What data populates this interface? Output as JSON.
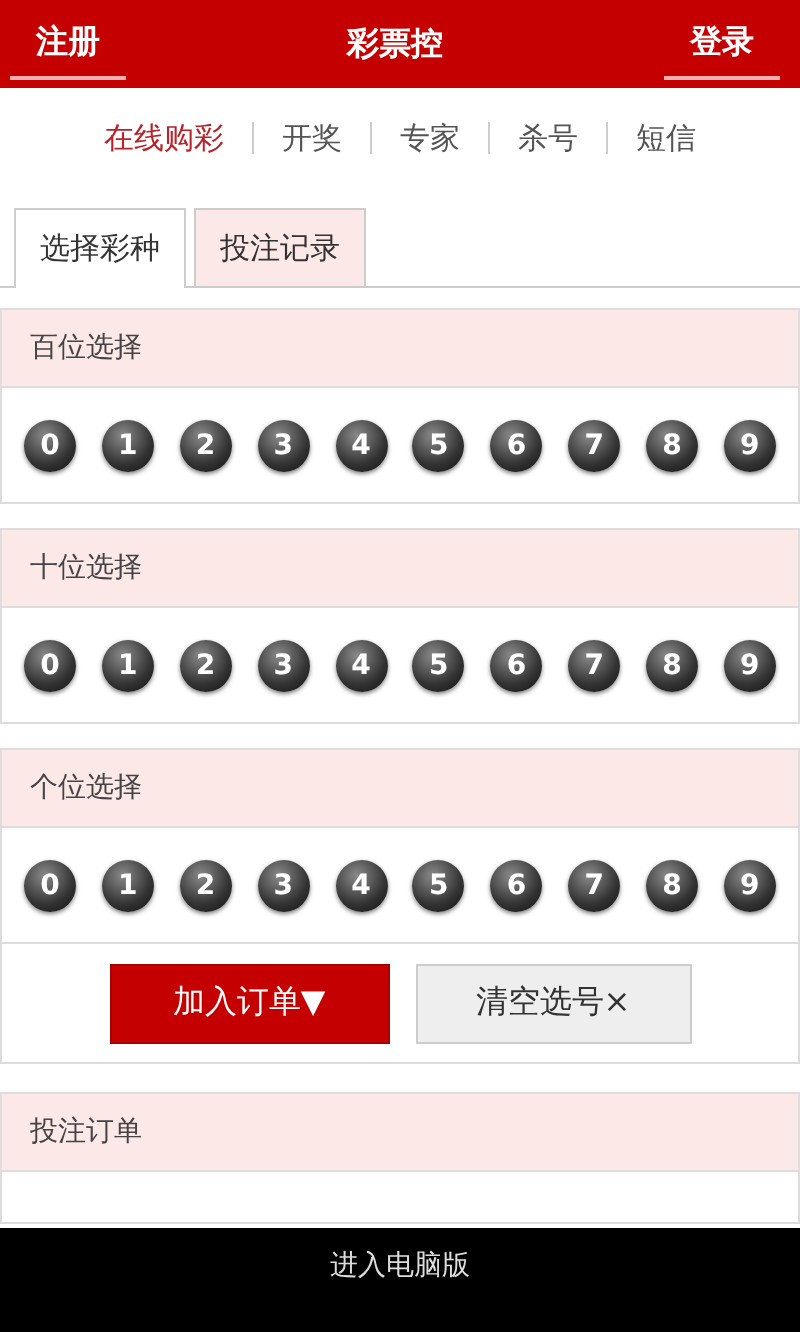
{
  "header": {
    "left_link": "注册",
    "title": "彩票控",
    "right_link": "登录"
  },
  "nav": [
    {
      "label": "在线购彩",
      "selected": true
    },
    {
      "label": "开奖",
      "selected": false
    },
    {
      "label": "专家",
      "selected": false
    },
    {
      "label": "杀号",
      "selected": false
    },
    {
      "label": "短信",
      "selected": false
    }
  ],
  "tabs": [
    {
      "label": "选择彩种",
      "selected": true
    },
    {
      "label": "投注记录",
      "selected": false
    }
  ],
  "sections": [
    {
      "title": "百位选择",
      "balls": [
        {
          "label": "0",
          "selected": false
        },
        {
          "label": "1",
          "selected": false
        },
        {
          "label": "2",
          "selected": false
        },
        {
          "label": "3",
          "selected": false
        },
        {
          "label": "4",
          "selected": false
        },
        {
          "label": "5",
          "selected": false
        },
        {
          "label": "6",
          "selected": false
        },
        {
          "label": "7",
          "selected": false
        },
        {
          "label": "8",
          "selected": false
        },
        {
          "label": "9",
          "selected": false
        }
      ]
    },
    {
      "title": "十位选择",
      "balls": [
        {
          "label": "0",
          "selected": false
        },
        {
          "label": "1",
          "selected": false
        },
        {
          "label": "2",
          "selected": false
        },
        {
          "label": "3",
          "selected": false
        },
        {
          "label": "4",
          "selected": false
        },
        {
          "label": "5",
          "selected": false
        },
        {
          "label": "6",
          "selected": false
        },
        {
          "label": "7",
          "selected": false
        },
        {
          "label": "8",
          "selected": false
        },
        {
          "label": "9",
          "selected": false
        }
      ]
    },
    {
      "title": "个位选择",
      "balls": [
        {
          "label": "0",
          "selected": false
        },
        {
          "label": "1",
          "selected": false
        },
        {
          "label": "2",
          "selected": false
        },
        {
          "label": "3",
          "selected": false
        },
        {
          "label": "4",
          "selected": false
        },
        {
          "label": "5",
          "selected": false
        },
        {
          "label": "6",
          "selected": false
        },
        {
          "label": "7",
          "selected": false
        },
        {
          "label": "8",
          "selected": false
        },
        {
          "label": "9",
          "selected": false
        }
      ]
    }
  ],
  "actions": {
    "add": "加入订单▼",
    "clear": "清空选号×"
  },
  "order": {
    "title": "投注订单"
  },
  "footer": {
    "link": "进入电脑版"
  }
}
